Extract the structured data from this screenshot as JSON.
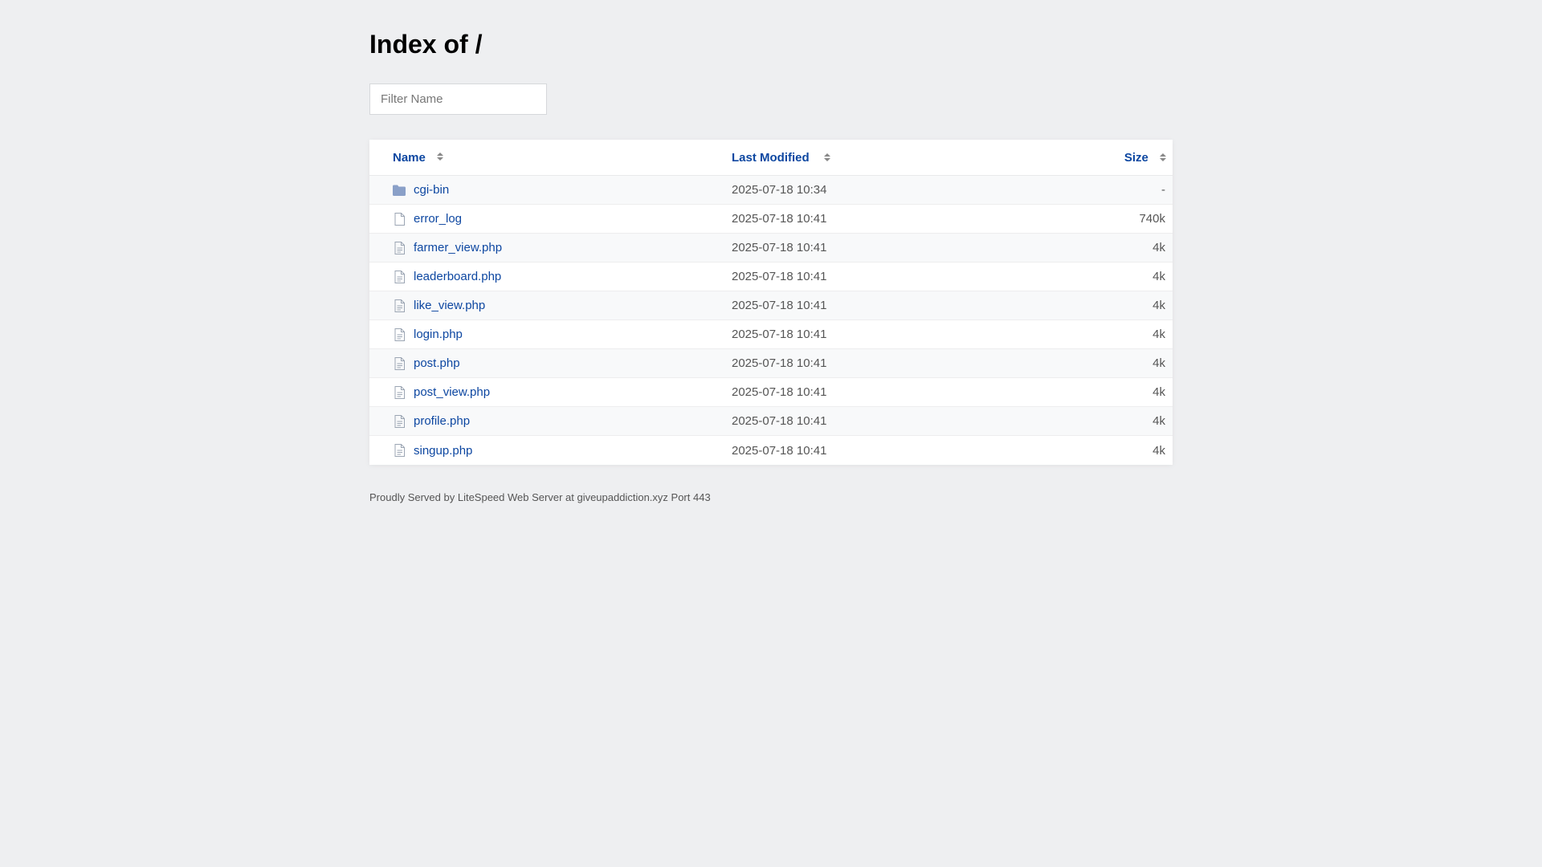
{
  "header": {
    "title": "Index of /"
  },
  "filter": {
    "placeholder": "Filter Name",
    "value": ""
  },
  "table": {
    "columns": {
      "name": "Name",
      "modified": "Last Modified",
      "size": "Size"
    },
    "rows": [
      {
        "name": "cgi-bin",
        "modified": "2025-07-18 10:34",
        "size": "-",
        "type": "folder-icon"
      },
      {
        "name": "error_log",
        "modified": "2025-07-18 10:41",
        "size": "740k",
        "type": "file-icon"
      },
      {
        "name": "farmer_view.php",
        "modified": "2025-07-18 10:41",
        "size": "4k",
        "type": "file-text-icon"
      },
      {
        "name": "leaderboard.php",
        "modified": "2025-07-18 10:41",
        "size": "4k",
        "type": "file-text-icon"
      },
      {
        "name": "like_view.php",
        "modified": "2025-07-18 10:41",
        "size": "4k",
        "type": "file-text-icon"
      },
      {
        "name": "login.php",
        "modified": "2025-07-18 10:41",
        "size": "4k",
        "type": "file-text-icon"
      },
      {
        "name": "post.php",
        "modified": "2025-07-18 10:41",
        "size": "4k",
        "type": "file-text-icon"
      },
      {
        "name": "post_view.php",
        "modified": "2025-07-18 10:41",
        "size": "4k",
        "type": "file-text-icon"
      },
      {
        "name": "profile.php",
        "modified": "2025-07-18 10:41",
        "size": "4k",
        "type": "file-text-icon"
      },
      {
        "name": "singup.php",
        "modified": "2025-07-18 10:41",
        "size": "4k",
        "type": "file-text-icon"
      }
    ]
  },
  "footer": {
    "text": "Proudly Served by LiteSpeed Web Server at giveupaddiction.xyz Port 443"
  },
  "colors": {
    "link": "#0d47a1",
    "background": "#eeeff1",
    "folder": "#8aa0c8",
    "file": "#9ba5b3"
  }
}
